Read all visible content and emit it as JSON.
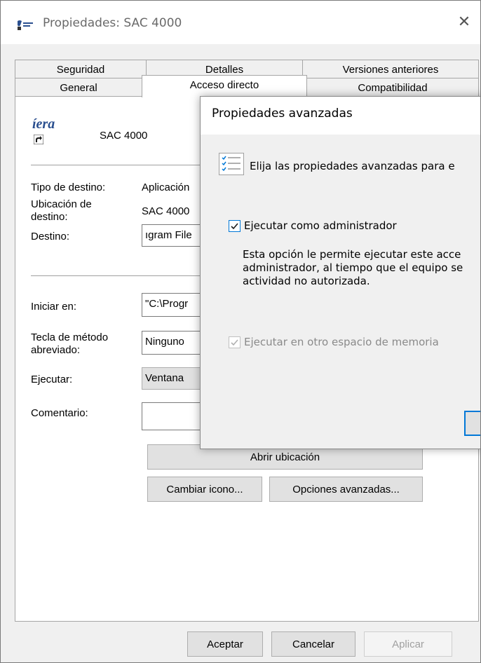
{
  "window": {
    "title": "Propiedades: SAC 4000",
    "close_glyph": "✕"
  },
  "tabs": {
    "row1": [
      "Seguridad",
      "Detalles",
      "Versiones anteriores"
    ],
    "row2": [
      "General",
      "Acceso directo",
      "Compatibilidad"
    ],
    "active": "Acceso directo"
  },
  "shortcut": {
    "logo_text": "íera",
    "name": "SAC 4000",
    "labels": {
      "tipo_destino": "Tipo de destino:",
      "ubicacion_destino_1": "Ubicación de",
      "ubicacion_destino_2": "destino:",
      "destino": "Destino:",
      "iniciar_en": "Iniciar en:",
      "tecla_1": "Tecla de método",
      "tecla_2": "abreviado:",
      "ejecutar": "Ejecutar:",
      "comentario": "Comentario:"
    },
    "values": {
      "tipo_destino": "Aplicación",
      "ubicacion_destino": "SAC 4000",
      "destino": "ıgram File",
      "iniciar_en": "\"C:\\Progr",
      "tecla": "Ninguno",
      "ejecutar": "Ventana",
      "comentario": ""
    },
    "buttons": {
      "abrir_ubicacion": "Abrir ubicación",
      "cambiar_icono": "Cambiar icono...",
      "opciones_avanzadas": "Opciones avanzadas..."
    }
  },
  "footer": {
    "aceptar": "Aceptar",
    "cancelar": "Cancelar",
    "aplicar": "Aplicar"
  },
  "dialog": {
    "title": "Propiedades avanzadas",
    "intro": "Elija las propiedades avanzadas para e",
    "run_as_admin": {
      "label": "Ejecutar como administrador",
      "checked": true
    },
    "description": [
      "Esta opción le permite ejecutar este acce",
      "administrador, al tiempo que el equipo se",
      "actividad no autorizada."
    ],
    "separate_memory": {
      "label": "Ejecutar en otro espacio de memoria",
      "checked": true,
      "disabled": true
    }
  },
  "colors": {
    "accent": "#0078d7",
    "logo": "#2a4f8f"
  }
}
